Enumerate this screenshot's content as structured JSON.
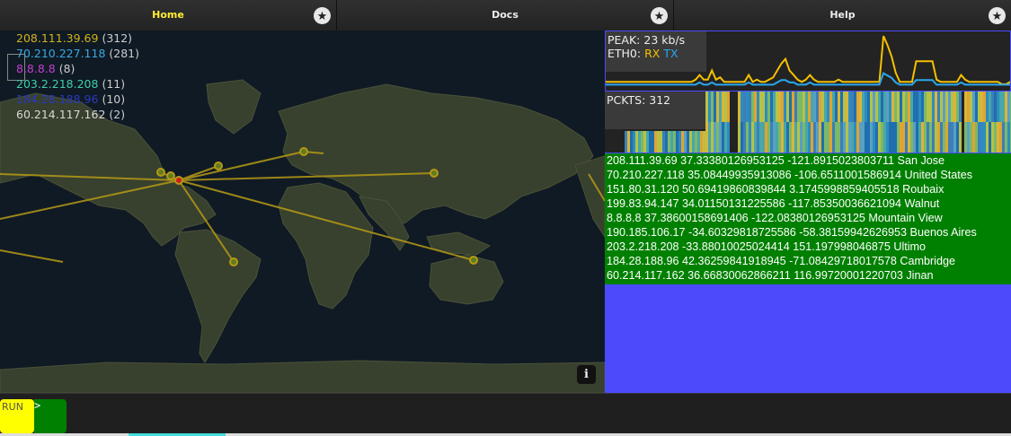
{
  "tabs": [
    {
      "label": "Home",
      "active": true
    },
    {
      "label": "Docs",
      "active": false
    },
    {
      "label": "Help",
      "active": false
    }
  ],
  "star_icon": "★",
  "legend": [
    {
      "ip": "208.111.39.69",
      "count": "(312)",
      "color": "#d4b21c"
    },
    {
      "ip": "70.210.227.118",
      "count": "(281)",
      "color": "#3ba9e0"
    },
    {
      "ip": "8.8.8.8",
      "count": "(8)",
      "color": "#c040d0"
    },
    {
      "ip": "203.2.218.208",
      "count": "(11)",
      "color": "#3fd0a8"
    },
    {
      "ip": "184.28.188.96",
      "count": "(10)",
      "color": "#2a3ac0"
    },
    {
      "ip": "60.214.117.162",
      "count": "(2)",
      "color": "#d8d8d8"
    }
  ],
  "info_label": "i",
  "bandwidth": {
    "peak_label": "PEAK: 23 kb/s",
    "eth_prefix": "ETH0: ",
    "rx_label": "RX",
    "tx_label": "TX",
    "rx_color": "#f5c000",
    "tx_color": "#2aa8ee",
    "rx_values": [
      3,
      3,
      3,
      3,
      3,
      3,
      3,
      3,
      3,
      3,
      3,
      3,
      3,
      3,
      3,
      3,
      3,
      3,
      3,
      3,
      3,
      3,
      4,
      6,
      4,
      4,
      8,
      4,
      5,
      3,
      3,
      3,
      3,
      3,
      3,
      6,
      3,
      4,
      3,
      3,
      4,
      5,
      8,
      11,
      13,
      8,
      6,
      4,
      3,
      4,
      6,
      4,
      3,
      3,
      3,
      3,
      3,
      4,
      3,
      3,
      3,
      3,
      3,
      3,
      3,
      3,
      3,
      3,
      23,
      19,
      14,
      7,
      3,
      3,
      3,
      3,
      12,
      12,
      12,
      12,
      12,
      4,
      3,
      3,
      3,
      3,
      3,
      6,
      4,
      3,
      3,
      3,
      3,
      3,
      3,
      3,
      3,
      2,
      2,
      3
    ]
  },
  "packets": {
    "label": "PCKTS: 312"
  },
  "geo_lines": [
    "208.111.39.69 37.33380126953125 -121.8915023803711 San Jose",
    "70.210.227.118 35.08449935913086 -106.6511001586914 United States",
    "151.80.31.120 50.69419860839844 3.1745998859405518 Roubaix",
    "199.83.94.147 34.01150131225586 -117.85350036621094 Walnut",
    "8.8.8.8 37.38600158691406 -122.08380126953125 Mountain View",
    "190.185.106.17 -34.60329818725586 -58.38159942626953 Buenos Aires",
    "203.2.218.208 -33.88010025024414 151.197998046875 Ultimo",
    "184.28.188.96 42.36259841918945 -71.08429718017578 Cambridge",
    "60.214.117.162 36.66830062866211 116.99720001220703 Jinan"
  ],
  "console": {
    "run_label": "RUN",
    "prompt": ">"
  }
}
